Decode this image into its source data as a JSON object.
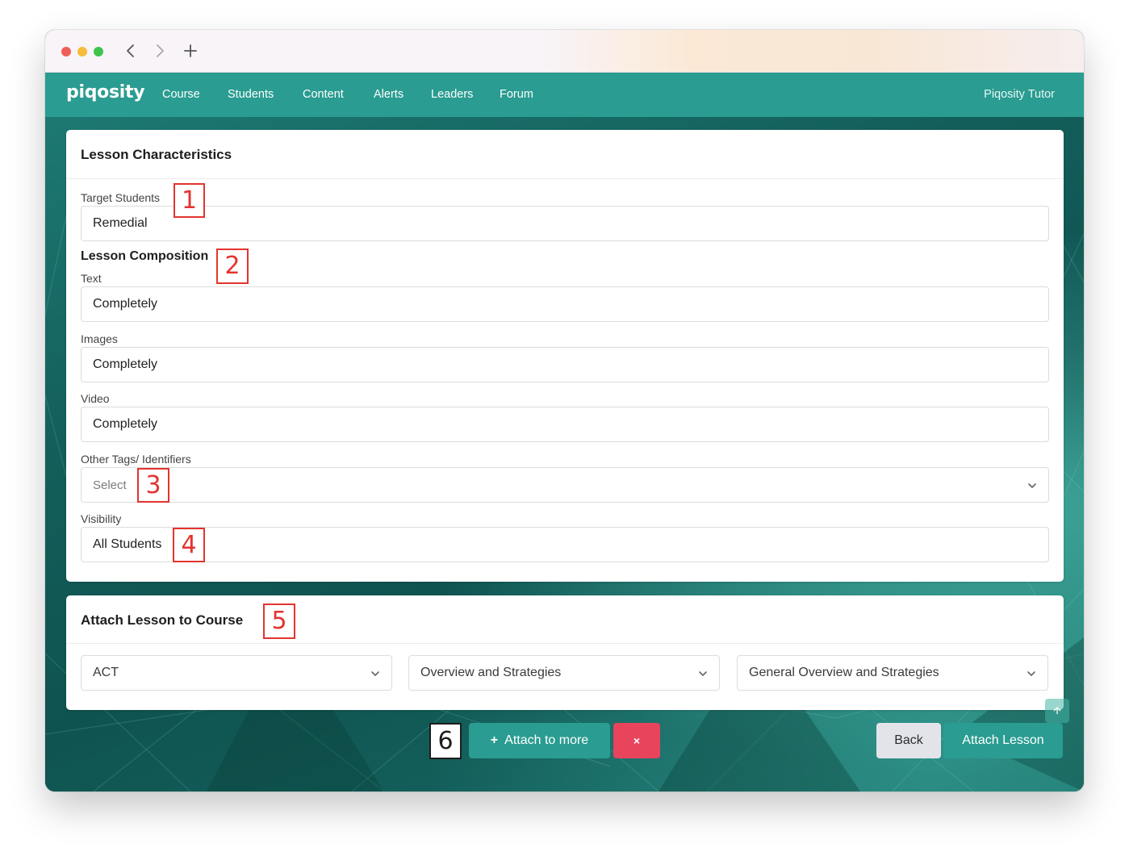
{
  "nav": {
    "brand": "piqosity",
    "links": [
      "Course",
      "Students",
      "Content",
      "Alerts",
      "Leaders",
      "Forum"
    ],
    "user": "Piqosity Tutor"
  },
  "lesson_characteristics": {
    "title": "Lesson Characteristics",
    "target_students_label": "Target Students",
    "target_students_value": "Remedial",
    "composition_heading": "Lesson Composition",
    "text_label": "Text",
    "text_value": "Completely",
    "images_label": "Images",
    "images_value": "Completely",
    "video_label": "Video",
    "video_value": "Completely",
    "tags_label": "Other Tags/ Identifiers",
    "tags_placeholder": "Select",
    "visibility_label": "Visibility",
    "visibility_value": "All Students"
  },
  "attach_course": {
    "title": "Attach Lesson to Course",
    "course": "ACT",
    "unit": "Overview and Strategies",
    "section": "General Overview and Strategies"
  },
  "actions": {
    "attach_more": "Attach to more",
    "remove": "×",
    "back": "Back",
    "attach_lesson": "Attach Lesson"
  },
  "markers": [
    "1",
    "2",
    "3",
    "4",
    "5",
    "6"
  ],
  "colors": {
    "brand": "#2a9c91",
    "danger": "#e8445c",
    "marker": "#e3342f"
  }
}
